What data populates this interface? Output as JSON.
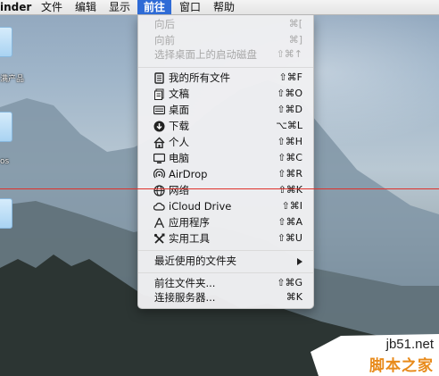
{
  "menubar": {
    "app_name": "inder",
    "items": [
      "文件",
      "编辑",
      "显示",
      "前往",
      "窗口",
      "帮助"
    ]
  },
  "desktop_icons": [
    {
      "label": "满产品"
    },
    {
      "label": ""
    },
    {
      "label": "os"
    },
    {
      "label": ""
    }
  ],
  "go_menu": {
    "nav": [
      {
        "label": "向后",
        "shortcut": "⌘[",
        "enabled": false
      },
      {
        "label": "向前",
        "shortcut": "⌘]",
        "enabled": false
      },
      {
        "label": "选择桌面上的启动磁盘",
        "shortcut": "⇧⌘↑",
        "enabled": false
      }
    ],
    "places": [
      {
        "label": "我的所有文件",
        "shortcut": "⇧⌘F",
        "icon": "all-files-icon"
      },
      {
        "label": "文稿",
        "shortcut": "⇧⌘O",
        "icon": "documents-icon"
      },
      {
        "label": "桌面",
        "shortcut": "⇧⌘D",
        "icon": "desktop-icon"
      },
      {
        "label": "下载",
        "shortcut": "⌥⌘L",
        "icon": "downloads-icon"
      },
      {
        "label": "个人",
        "shortcut": "⇧⌘H",
        "icon": "home-icon"
      },
      {
        "label": "电脑",
        "shortcut": "⇧⌘C",
        "icon": "computer-icon"
      },
      {
        "label": "AirDrop",
        "shortcut": "⇧⌘R",
        "icon": "airdrop-icon"
      },
      {
        "label": "网络",
        "shortcut": "⇧⌘K",
        "icon": "network-icon"
      },
      {
        "label": "iCloud Drive",
        "shortcut": "⇧⌘I",
        "icon": "icloud-icon"
      },
      {
        "label": "应用程序",
        "shortcut": "⇧⌘A",
        "icon": "applications-icon"
      },
      {
        "label": "实用工具",
        "shortcut": "⇧⌘U",
        "icon": "utilities-icon"
      }
    ],
    "recent": {
      "label": "最近使用的文件夹"
    },
    "actions": [
      {
        "label": "前往文件夹...",
        "shortcut": "⇧⌘G"
      },
      {
        "label": "连接服务器...",
        "shortcut": "⌘K"
      }
    ]
  },
  "watermark": {
    "domain": "jb51.net",
    "text": "脚本之家"
  }
}
